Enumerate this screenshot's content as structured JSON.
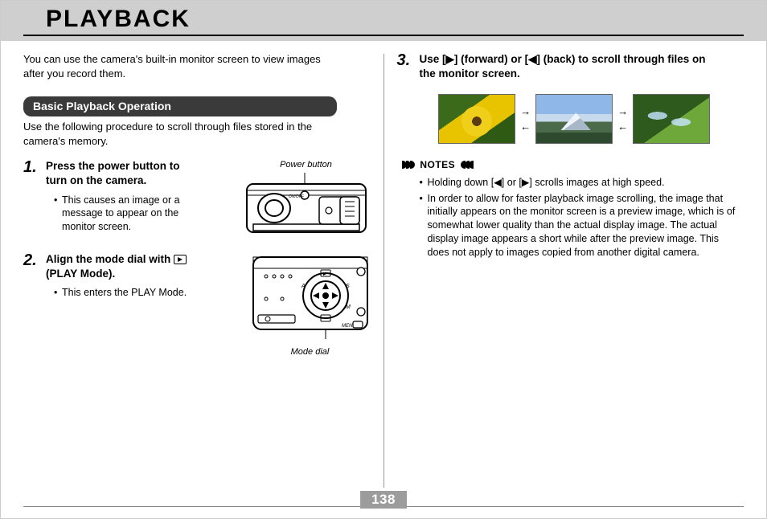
{
  "title": "PLAYBACK",
  "page_number": "138",
  "left": {
    "intro": "You can use the camera's built-in monitor screen to view images after you record them.",
    "section_header": "Basic Playback Operation",
    "section_sub": "Use the following procedure to scroll through files stored in the camera's memory.",
    "step1": {
      "num": "1.",
      "title": "Press the power button to turn on the camera.",
      "bullet": "This causes an image or a message to appear on the monitor screen.",
      "diagram_label": "Power button"
    },
    "step2": {
      "num": "2.",
      "title_pre": "Align the mode dial with ",
      "title_post": " (PLAY Mode).",
      "bullet": "This enters the PLAY Mode.",
      "diagram_label": "Mode dial"
    }
  },
  "right": {
    "step3": {
      "num": "3.",
      "title": "Use [▶] (forward) or [◀] (back) to scroll through files on the monitor screen."
    },
    "notes_label": "NOTES",
    "notes": [
      "Holding down [◀] or [▶] scrolls images at high speed.",
      "In order to allow for faster playback image scrolling, the image that initially appears on the monitor screen is a preview image, which is of somewhat lower quality than the actual display image. The actual display image appears a short while after the preview image. This does not apply to images copied from another digital camera."
    ]
  }
}
